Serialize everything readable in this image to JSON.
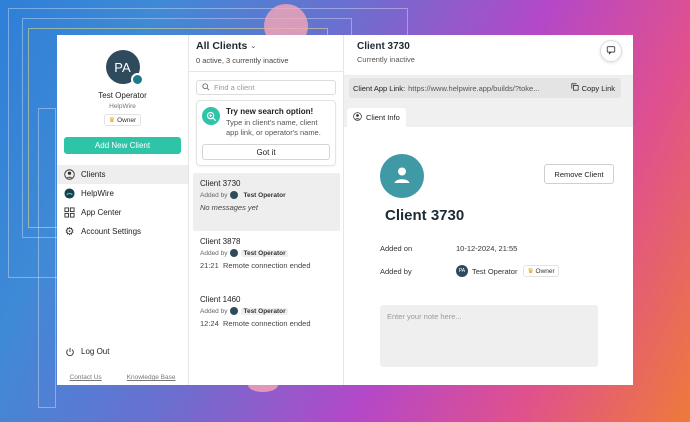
{
  "sidebar": {
    "avatar_initials": "PA",
    "operator_name": "Test Operator",
    "organization": "HelpWire",
    "role": "Owner",
    "add_client_label": "Add New Client",
    "nav": [
      {
        "label": "Clients",
        "icon": "user-circle-icon"
      },
      {
        "label": "HelpWire",
        "icon": "helpwire-logo-icon"
      },
      {
        "label": "App Center",
        "icon": "grid-icon"
      },
      {
        "label": "Account Settings",
        "icon": "gear-icon"
      }
    ],
    "logout_label": "Log Out",
    "footer": {
      "contact": "Contact Us",
      "kb": "Knowledge Base"
    }
  },
  "client_list": {
    "title": "All Clients",
    "subtitle": "0 active, 3 currently inactive",
    "search_placeholder": "Find a client",
    "tip": {
      "title": "Try new search option!",
      "text": "Type in client's name, client app link, or operator's name.",
      "button": "Got it"
    },
    "clients": [
      {
        "name": "Client 3730",
        "added_prefix": "Added by",
        "operator": "Test Operator",
        "time": "",
        "message": "No messages yet"
      },
      {
        "name": "Client 3878",
        "added_prefix": "Added by",
        "operator": "Test Operator",
        "time": "21:21",
        "message": "Remote connection ended"
      },
      {
        "name": "Client 1460",
        "added_prefix": "Added by",
        "operator": "Test Operator",
        "time": "12:24",
        "message": "Remote connection ended"
      }
    ]
  },
  "detail": {
    "title": "Client 3730",
    "status": "Currently inactive",
    "link_label": "Client App Link:",
    "link_value": "https://www.helpwire.app/builds/?toke...",
    "copy_label": "Copy Link",
    "tab_label": "Client Info",
    "remove_label": "Remove Client",
    "client_name": "Client 3730",
    "added_on_label": "Added on",
    "added_on_value": "10-12-2024, 21:55",
    "added_by_label": "Added by",
    "added_by_initials": "PA",
    "added_by_name": "Test Operator",
    "added_by_role": "Owner",
    "note_placeholder": "Enter your note here..."
  },
  "colors": {
    "accent": "#2ec4a8",
    "avatar": "#2f4a5c",
    "client_avatar": "#3f9aa6"
  }
}
